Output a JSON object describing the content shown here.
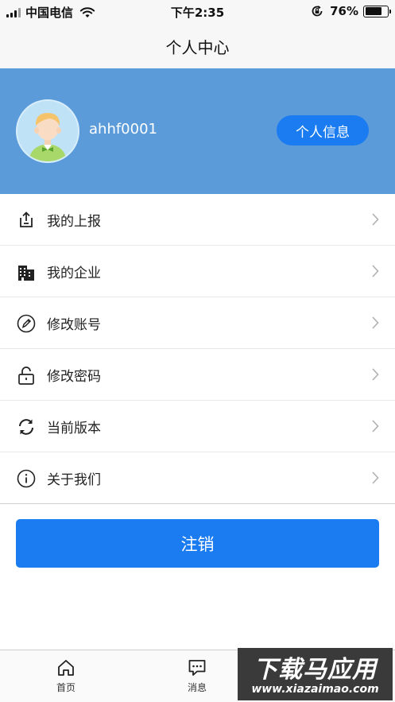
{
  "status_bar": {
    "carrier": "中国电信",
    "time": "下午2:35",
    "battery_percent": "76%",
    "battery_level": 0.76,
    "icons": [
      "signal-icon",
      "wifi-icon",
      "rotation-lock-icon",
      "battery-icon"
    ]
  },
  "nav": {
    "title": "个人中心"
  },
  "profile": {
    "username": "ahhf0001",
    "info_button": "个人信息",
    "background_color": "#5b9bd9",
    "avatar_icon": "user-avatar-icon"
  },
  "menu": {
    "items": [
      {
        "label": "我的上报",
        "icon": "upload-icon"
      },
      {
        "label": "我的企业",
        "icon": "building-icon"
      },
      {
        "label": "修改账号",
        "icon": "edit-icon"
      },
      {
        "label": "修改密码",
        "icon": "unlock-icon"
      },
      {
        "label": "当前版本",
        "icon": "refresh-icon"
      },
      {
        "label": "关于我们",
        "icon": "info-icon"
      }
    ]
  },
  "logout": {
    "label": "注销",
    "color": "#1a7cf0"
  },
  "tab_bar": {
    "tabs": [
      {
        "label": "首页",
        "icon": "home-icon"
      },
      {
        "label": "消息",
        "icon": "message-icon"
      }
    ]
  },
  "watermark": {
    "title": "下载马应用",
    "url": "www.xiazaimao.com"
  }
}
